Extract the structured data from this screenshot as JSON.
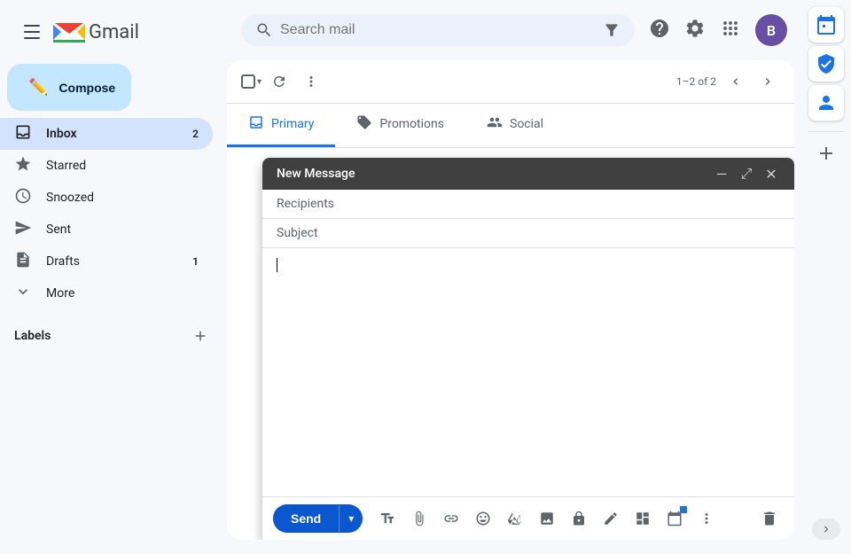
{
  "app": {
    "title": "Gmail",
    "logo_text": "Gmail"
  },
  "search": {
    "placeholder": "Search mail"
  },
  "compose": {
    "button_label": "Compose"
  },
  "nav": {
    "items": [
      {
        "id": "inbox",
        "label": "Inbox",
        "icon": "inbox",
        "badge": "2",
        "active": true
      },
      {
        "id": "starred",
        "label": "Starred",
        "icon": "star",
        "badge": "",
        "active": false
      },
      {
        "id": "snoozed",
        "label": "Snoozed",
        "icon": "clock",
        "badge": "",
        "active": false
      },
      {
        "id": "sent",
        "label": "Sent",
        "icon": "send",
        "badge": "",
        "active": false
      },
      {
        "id": "drafts",
        "label": "Drafts",
        "icon": "draft",
        "badge": "1",
        "active": false
      },
      {
        "id": "more",
        "label": "More",
        "icon": "chevron-down",
        "badge": "",
        "active": false
      }
    ]
  },
  "labels": {
    "title": "Labels",
    "add_icon": "+"
  },
  "toolbar": {
    "pagination": "1–2 of 2"
  },
  "tabs": [
    {
      "id": "primary",
      "label": "Primary",
      "icon": "inbox",
      "active": true
    },
    {
      "id": "promotions",
      "label": "Promotions",
      "icon": "tag",
      "active": false
    },
    {
      "id": "social",
      "label": "Social",
      "icon": "people",
      "active": false
    }
  ],
  "compose_window": {
    "title": "New Message",
    "recipients_placeholder": "Recipients",
    "subject_placeholder": "Subject",
    "send_label": "Send",
    "minimize_icon": "—",
    "maximize_icon": "⤢",
    "close_icon": "✕"
  },
  "right_panel": {
    "icons": [
      {
        "id": "calendar",
        "symbol": "📅"
      },
      {
        "id": "tasks",
        "symbol": "✓"
      },
      {
        "id": "contacts",
        "symbol": "👤"
      }
    ],
    "add_icon": "+",
    "expand_icon": "❯"
  },
  "user": {
    "avatar_letter": "B",
    "avatar_bg": "#6750a4"
  }
}
